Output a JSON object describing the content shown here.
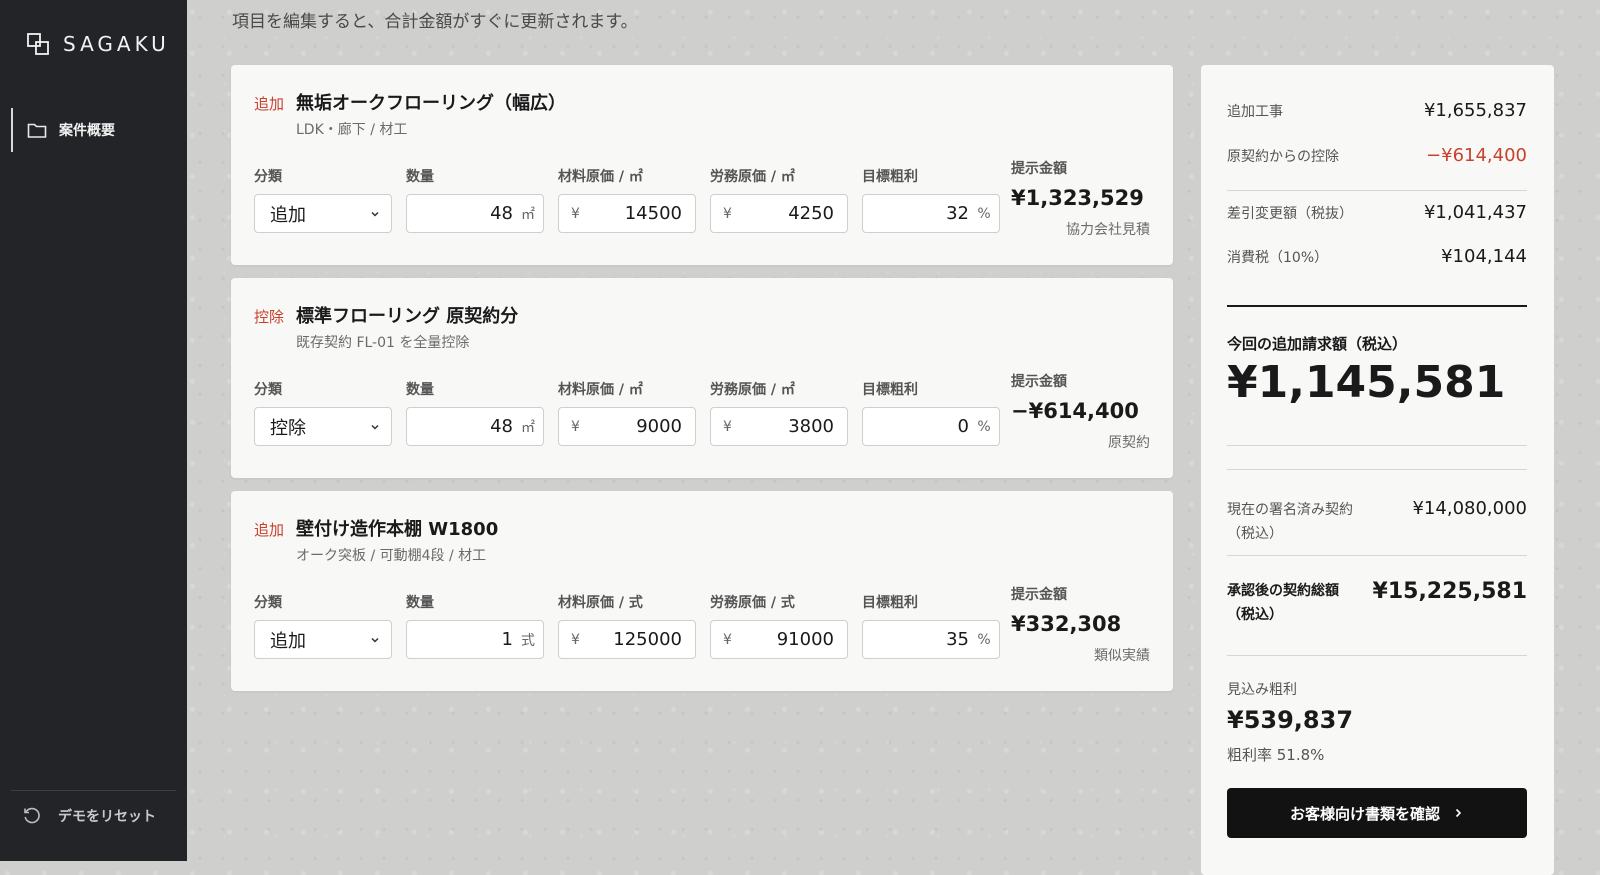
{
  "brand": {
    "name": "SAGAKU"
  },
  "sidebar": {
    "nav": [
      {
        "label": "案件概要",
        "icon": "folder-icon"
      }
    ],
    "reset_label": "デモをリセット"
  },
  "hint": "項目を編集すると、合計金額がすぐに更新されます。",
  "labels": {
    "category": "分類",
    "quantity": "数量",
    "target_margin": "目標粗利",
    "price": "提示金額",
    "yen": "¥",
    "percent": "%"
  },
  "items": [
    {
      "badge": "追加",
      "title": "無垢オークフローリング（幅広）",
      "subtitle": "LDK・廊下 / 材工",
      "material_label": "材料原価 / ㎡",
      "labor_label": "労務原価 / ㎡",
      "category": "追加",
      "quantity": "48",
      "unit": "㎡",
      "material_cost": "14500",
      "labor_cost": "4250",
      "margin": "32",
      "price": "¥1,323,529",
      "note": "協力会社見積"
    },
    {
      "badge": "控除",
      "title": "標準フローリング 原契約分",
      "subtitle": "既存契約 FL-01 を全量控除",
      "material_label": "材料原価 / ㎡",
      "labor_label": "労務原価 / ㎡",
      "category": "控除",
      "quantity": "48",
      "unit": "㎡",
      "material_cost": "9000",
      "labor_cost": "3800",
      "margin": "0",
      "price": "−¥614,400",
      "note": "原契約"
    },
    {
      "badge": "追加",
      "title": "壁付け造作本棚 W1800",
      "subtitle": "オーク突板 / 可動棚4段 / 材工",
      "material_label": "材料原価 / 式",
      "labor_label": "労務原価 / 式",
      "category": "追加",
      "quantity": "1",
      "unit": "式",
      "material_cost": "125000",
      "labor_cost": "91000",
      "margin": "35",
      "price": "¥332,308",
      "note": "類似実績"
    }
  ],
  "summary": {
    "additional_label": "追加工事",
    "additional_value": "¥1,655,837",
    "deduction_label": "原契約からの控除",
    "deduction_value": "−¥614,400",
    "diff_label": "差引変更額（税抜）",
    "diff_value": "¥1,041,437",
    "tax_label": "消費税（10%）",
    "tax_value": "¥104,144",
    "claim_label": "今回の追加請求額（税込）",
    "claim_value": "¥1,145,581",
    "current_label_1": "現在の署名済み契約",
    "current_label_2": "（税込）",
    "current_value": "¥14,080,000",
    "after_label_1": "承認後の契約総額",
    "after_label_2": "（税込）",
    "after_value": "¥15,225,581",
    "profit_label": "見込み粗利",
    "profit_value": "¥539,837",
    "profit_rate": "粗利率 51.8%",
    "cta_label": "お客様向け書類を確認"
  }
}
